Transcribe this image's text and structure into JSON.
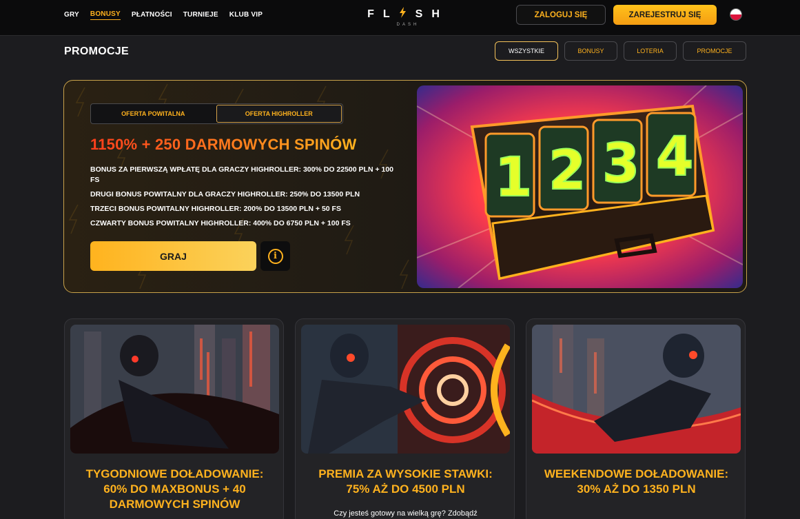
{
  "nav": {
    "items": [
      {
        "label": "GRY",
        "active": false
      },
      {
        "label": "BONUSY",
        "active": true
      },
      {
        "label": "PŁATNOŚCI",
        "active": false
      },
      {
        "label": "TURNIEJE",
        "active": false
      },
      {
        "label": "KLUB VIP",
        "active": false
      }
    ]
  },
  "logo": {
    "word_left": "FL",
    "word_right": "SH",
    "sub": "DASH"
  },
  "auth": {
    "login_label": "ZALOGUJ SIĘ",
    "register_label": "ZAREJESTRUJ SIĘ"
  },
  "language": {
    "flag_icon": "poland-flag-icon"
  },
  "page": {
    "title": "PROMOCJE"
  },
  "filters": [
    {
      "label": "WSZYSTKIE",
      "active": true
    },
    {
      "label": "BONUSY",
      "active": false
    },
    {
      "label": "LOTERIA",
      "active": false
    },
    {
      "label": "PROMOCJE",
      "active": false
    }
  ],
  "hero": {
    "tabs": [
      {
        "label": "OFERTA POWITALNA",
        "active": false
      },
      {
        "label": "OFERTA HIGHROLLER",
        "active": true
      }
    ],
    "title": "1150% + 250 DARMOWYCH SPINÓW",
    "lines": [
      "BONUS ZA PIERWSZĄ WPŁATĘ DLA GRACZY HIGHROLLER: 300% DO 22500 PLN + 100 FS",
      "DRUGI BONUS POWITALNY DLA GRACZY HIGHROLLER: 250% DO 13500 PLN",
      "TRZECI BONUS POWITALNY HIGHROLLER: 200% DO 13500 PLN + 50 FS",
      "CZWARTY BONUS POWITALNY HIGHROLLER: 400% DO 6750 PLN + 100 FS"
    ],
    "play_label": "GRAJ",
    "info_icon_glyph": "i",
    "image_digits": [
      "1",
      "2",
      "3",
      "4"
    ]
  },
  "cards": [
    {
      "title": "TYGODNIOWE DOŁADOWANIE: 60% DO MAXBONUS + 40 DARMOWYCH SPINÓW",
      "desc": ""
    },
    {
      "title": "PREMIA ZA WYSOKIE STAWKI: 75% AŻ DO 4500 PLN",
      "desc": "Czy jesteś gotowy na wielką grę? Zdobądź"
    },
    {
      "title": "WEEKENDOWE DOŁADOWANIE: 30% AŻ DO 1350 PLN",
      "desc": ""
    }
  ],
  "colors": {
    "accent": "#ffb21e",
    "accent_red": "#ff3e1c",
    "background": "#1c1c1f",
    "header": "#0b0b0c"
  }
}
